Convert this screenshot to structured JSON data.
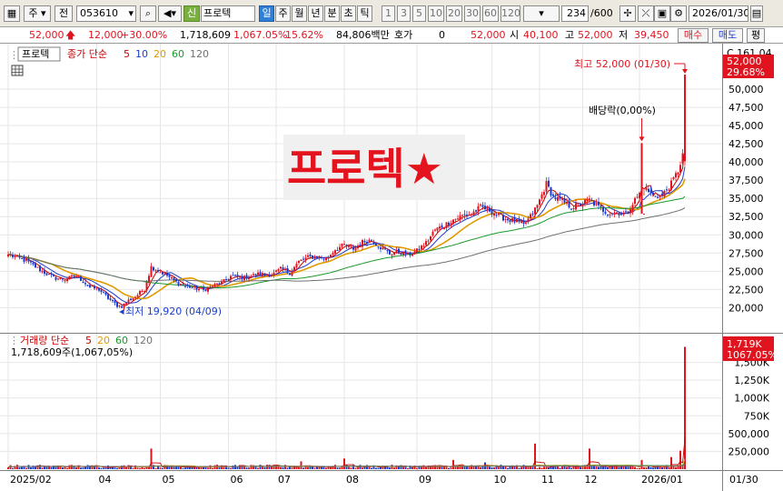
{
  "toolbar": {
    "market": "주",
    "scope": "전",
    "stock_code": "053610",
    "badge": "신",
    "stock_name": "프로텍",
    "periods": [
      "일",
      "주",
      "월",
      "년",
      "분",
      "초",
      "틱"
    ],
    "active_period": "일",
    "intervals": [
      "1",
      "3",
      "5",
      "10",
      "20",
      "30",
      "60",
      "120"
    ],
    "count": "234",
    "max_count": "/600",
    "date": "2026/01/30"
  },
  "quote": {
    "price": "52,000",
    "change": "12,000",
    "change_pct": "+30.00%",
    "volume": "1,718,609",
    "volume_ratio": "1,067.05%",
    "turnover_rate": "15.62%",
    "amount": "84,806백만",
    "hoga_label": "호가",
    "hoga": "0",
    "bid_price": "52,000",
    "open_label": "시",
    "open": "40,100",
    "high_label": "고",
    "high": "52,000",
    "low_label": "저",
    "low": "39,450",
    "buy_label": "매수",
    "sell_label": "매도",
    "eval_label": "평"
  },
  "price_panel": {
    "tab": "프로텍",
    "legend_name": "종가 단순",
    "legend_periods": [
      "5",
      "10",
      "20",
      "60",
      "120"
    ],
    "watermark": "프로텍★",
    "marker_high": "최고 52,000 (01/30)",
    "marker_low": "최저 19,920 (04/09)",
    "marker_div": "배당락(0,00%)",
    "corner": "C 161.04",
    "current_price_label": "52,000",
    "current_pct_label": "29.68%"
  },
  "volume_panel": {
    "legend_name": "거래량 단순",
    "legend_periods": [
      "5",
      "20",
      "60",
      "120"
    ],
    "volume_text": "1,718,609주(1,067,05%)",
    "current_vol_label": "1,719K",
    "current_vol_pct": "1067.05%"
  },
  "colors": {
    "up": "#e0141e",
    "down": "#1a3ccc",
    "ma5": "#cc0000",
    "ma10": "#1a3ccc",
    "ma20": "#e09a00",
    "ma60": "#1a9a2a",
    "ma120": "#707070"
  },
  "chart_data": [
    {
      "type": "candlestick",
      "title": "프로텍★",
      "x": [
        "2025/02",
        "04",
        "05",
        "06",
        "07",
        "08",
        "09",
        "10",
        "11",
        "12",
        "2026/01",
        "01/30"
      ],
      "ylim": [
        18800,
        53500
      ],
      "y_ticks": [
        20000,
        22500,
        25000,
        27500,
        30000,
        32500,
        35000,
        37500,
        40000,
        42500,
        45000,
        47500,
        50000
      ],
      "y_tick_labels": [
        "20,000",
        "22,500",
        "25,000",
        "27,500",
        "30,000",
        "32,500",
        "35,000",
        "37,500",
        "40,000",
        "42,500",
        "45,000",
        "47,500",
        "50,000"
      ],
      "anchors": [
        [
          0,
          27300
        ],
        [
          8,
          26400
        ],
        [
          14,
          25200
        ],
        [
          20,
          24100
        ],
        [
          25,
          23900
        ],
        [
          30,
          24400
        ],
        [
          36,
          22800
        ],
        [
          40,
          22500
        ],
        [
          44,
          21300
        ],
        [
          48,
          20300
        ],
        [
          50,
          20200
        ],
        [
          53,
          21000
        ],
        [
          56,
          21500
        ],
        [
          60,
          22600
        ],
        [
          63,
          25600
        ],
        [
          66,
          25100
        ],
        [
          70,
          24400
        ],
        [
          74,
          23500
        ],
        [
          78,
          23000
        ],
        [
          82,
          22700
        ],
        [
          86,
          22400
        ],
        [
          90,
          23000
        ],
        [
          94,
          23400
        ],
        [
          98,
          24300
        ],
        [
          104,
          24100
        ],
        [
          110,
          24600
        ],
        [
          116,
          24500
        ],
        [
          120,
          25300
        ],
        [
          124,
          24800
        ],
        [
          128,
          26300
        ],
        [
          132,
          26900
        ],
        [
          136,
          27000
        ],
        [
          140,
          26700
        ],
        [
          144,
          28000
        ],
        [
          148,
          28600
        ],
        [
          152,
          28100
        ],
        [
          156,
          29000
        ],
        [
          160,
          29300
        ],
        [
          164,
          28300
        ],
        [
          168,
          27400
        ],
        [
          172,
          27700
        ],
        [
          176,
          27200
        ],
        [
          180,
          27800
        ],
        [
          184,
          28900
        ],
        [
          188,
          30700
        ],
        [
          192,
          31300
        ],
        [
          196,
          32100
        ],
        [
          200,
          32600
        ],
        [
          204,
          32900
        ],
        [
          208,
          33800
        ],
        [
          212,
          33400
        ],
        [
          216,
          32600
        ],
        [
          220,
          32100
        ],
        [
          224,
          31800
        ],
        [
          227,
          31300
        ],
        [
          230,
          32500
        ],
        [
          233,
          34000
        ],
        [
          237,
          37000
        ],
        [
          240,
          35200
        ],
        [
          244,
          34600
        ],
        [
          248,
          33800
        ],
        [
          252,
          34200
        ],
        [
          256,
          34800
        ],
        [
          260,
          33800
        ],
        [
          264,
          33000
        ],
        [
          268,
          33100
        ],
        [
          272,
          32900
        ],
        [
          276,
          34800
        ],
        [
          280,
          36500
        ],
        [
          284,
          35400
        ],
        [
          288,
          35400
        ],
        [
          292,
          37000
        ],
        [
          295,
          38800
        ],
        [
          297,
          41000
        ],
        [
          298,
          52000
        ]
      ],
      "special_candles": [
        {
          "index": 279,
          "open": 32900,
          "close": 42600
        }
      ],
      "ma_periods": [
        5,
        10,
        20,
        60,
        120
      ],
      "annotations": [
        {
          "text": "최고 52,000 (01/30)",
          "value": 52000
        },
        {
          "text": "최저 19,920 (04/09)",
          "value": 19920
        },
        {
          "text": "배당락(0,00%)"
        }
      ]
    },
    {
      "type": "bar",
      "title": "거래량",
      "ylim": [
        0,
        1840000
      ],
      "y_ticks": [
        250000,
        500000,
        750000,
        1000000,
        1250000,
        1500000
      ],
      "y_tick_labels": [
        "250,000",
        "500,000",
        "750K",
        "1,000K",
        "1,250K",
        "1,500K"
      ],
      "base_volume": 35000,
      "spikes": [
        [
          63,
          290000
        ],
        [
          129,
          110000
        ],
        [
          148,
          150000
        ],
        [
          196,
          130000
        ],
        [
          210,
          95000
        ],
        [
          232,
          360000
        ],
        [
          256,
          290000
        ],
        [
          279,
          130000
        ],
        [
          292,
          170000
        ],
        [
          296,
          260000
        ],
        [
          298,
          1718609
        ]
      ]
    }
  ]
}
